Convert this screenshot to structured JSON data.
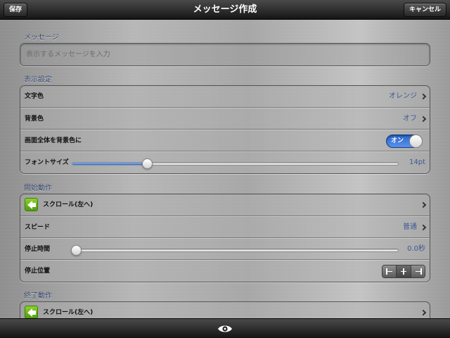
{
  "nav": {
    "save_label": "保存",
    "title": "メッセージ作成",
    "cancel_label": "キャンセル"
  },
  "message": {
    "section_title": "メッセージ",
    "placeholder": "表示するメッセージを入力",
    "value": ""
  },
  "display_settings": {
    "section_title": "表示設定",
    "text_color_label": "文字色",
    "text_color_value": "オレンジ",
    "background_color_label": "背景色",
    "background_color_value": "オフ",
    "fullscreen_bg_label": "画面全体を背景色に",
    "fullscreen_bg_toggle": "オン",
    "font_size_label": "フォントサイズ",
    "font_size_value": "14pt",
    "font_size_fraction": 0.23
  },
  "start_action": {
    "section_title": "開始動作",
    "direction_label": "スクロール(左へ)",
    "speed_label": "スピード",
    "speed_value": "普通",
    "pause_time_label": "停止時間",
    "pause_time_value": "0.0秒",
    "pause_time_fraction": 0.0,
    "stop_position_label": "停止位置",
    "stop_position_selected": 1
  },
  "end_action": {
    "section_title": "終了動作",
    "direction_label": "スクロール(左へ)"
  },
  "colors": {
    "accent_blue": "#2a66cc",
    "value_text": "#3e5a93",
    "direction_icon_green": "#6bb81c"
  },
  "icons": {
    "direction": "left-arrow-icon",
    "disclosure": "chevron-right-icon",
    "preview": "eye-icon"
  }
}
